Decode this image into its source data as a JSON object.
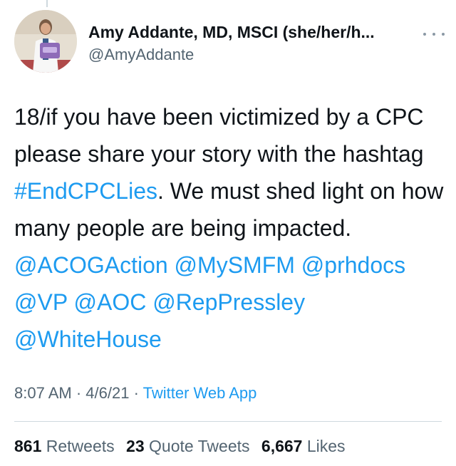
{
  "user": {
    "display_name": "Amy Addante, MD, MSCI (she/her/h...",
    "handle": "@AmyAddante"
  },
  "tweet": {
    "segments": [
      {
        "text": "18/if you have been victimized by a CPC please share your story with the hashtag ",
        "link": false
      },
      {
        "text": "#EndCPCLies",
        "link": true
      },
      {
        "text": ". We must shed light on how many people are being impacted. ",
        "link": false
      },
      {
        "text": "@ACOGAction",
        "link": true
      },
      {
        "text": " ",
        "link": false
      },
      {
        "text": "@MySMFM",
        "link": true
      },
      {
        "text": " ",
        "link": false
      },
      {
        "text": "@prhdocs",
        "link": true
      },
      {
        "text": " ",
        "link": false
      },
      {
        "text": "@VP",
        "link": true
      },
      {
        "text": " ",
        "link": false
      },
      {
        "text": "@AOC",
        "link": true
      },
      {
        "text": " ",
        "link": false
      },
      {
        "text": "@RepPressley",
        "link": true
      },
      {
        "text": " ",
        "link": false
      },
      {
        "text": "@WhiteHouse",
        "link": true
      }
    ]
  },
  "meta": {
    "time": "8:07 AM",
    "separator": " · ",
    "date": "4/6/21",
    "source": "Twitter Web App"
  },
  "stats": {
    "retweets_count": "861",
    "retweets_label": "Retweets",
    "quote_count": "23",
    "quote_label": "Quote Tweets",
    "likes_count": "6,667",
    "likes_label": "Likes"
  },
  "icons": {
    "more": "more-horizontal-icon"
  },
  "colors": {
    "link": "#1d9bf0",
    "secondary_text": "#536471",
    "primary_text": "#0f1419",
    "divider": "#cfd9de"
  }
}
